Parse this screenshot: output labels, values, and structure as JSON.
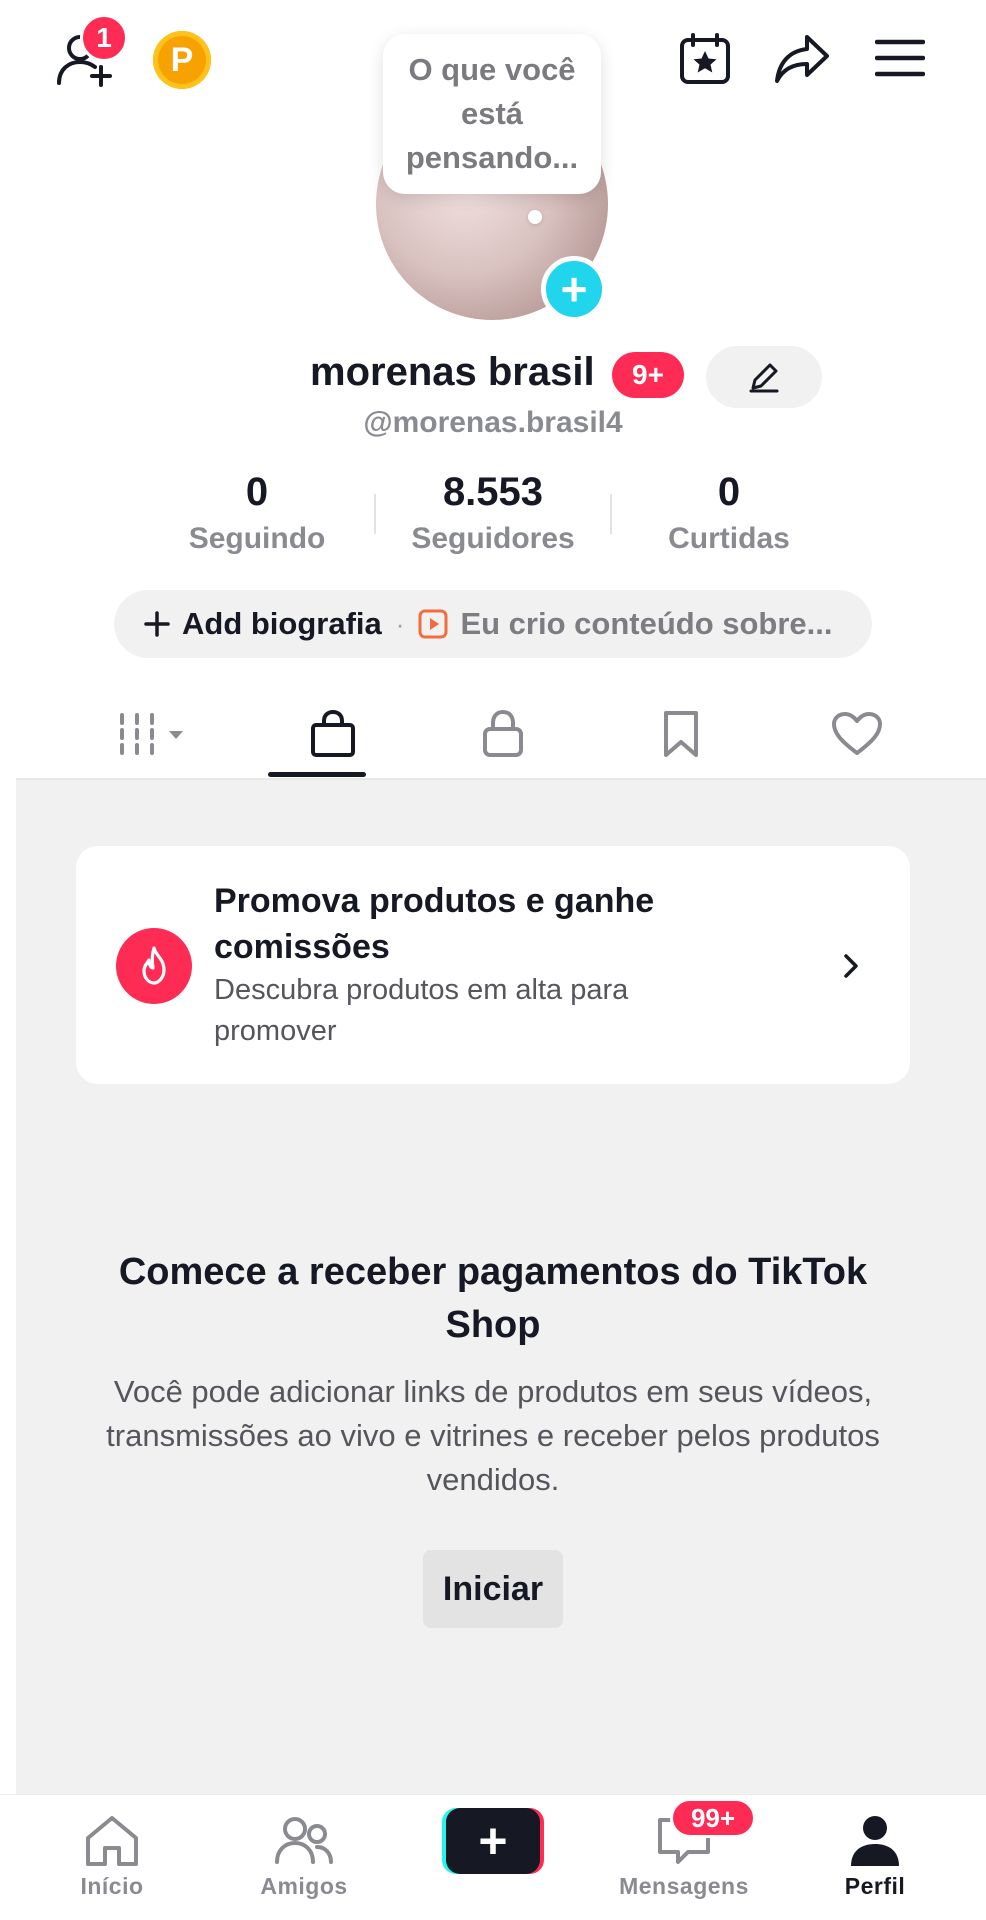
{
  "topbar": {
    "friends_badge": "1",
    "coin_label": "P"
  },
  "profile": {
    "thought_bubble": "O que você está pensando...",
    "display_name": "morenas brasil",
    "name_badge": "9+",
    "handle": "@morenas.brasil4"
  },
  "stats": [
    {
      "value": "0",
      "label": "Seguindo"
    },
    {
      "value": "8.553",
      "label": "Seguidores"
    },
    {
      "value": "0",
      "label": "Curtidas"
    }
  ],
  "bio": {
    "add_label": "Add biografia",
    "separator": "·",
    "hint": "Eu crio conteúdo sobre..."
  },
  "tabs": [
    {
      "icon": "grid-icon"
    },
    {
      "icon": "shopping-bag-icon"
    },
    {
      "icon": "lock-icon"
    },
    {
      "icon": "bookmark-icon"
    },
    {
      "icon": "heart-icon"
    }
  ],
  "promo": {
    "title": "Promova produtos e ganhe comissões",
    "subtitle": "Descubra produtos em alta para promover"
  },
  "shop": {
    "title": "Comece a receber pagamentos do TikTok Shop",
    "description": "Você pode adicionar links de produtos em seus vídeos, transmissões ao vivo e vitrines e receber pelos produtos vendidos.",
    "button": "Iniciar"
  },
  "bottom_nav": {
    "home": "Início",
    "friends": "Amigos",
    "messages": "Mensagens",
    "messages_badge": "99+",
    "profile": "Perfil"
  },
  "colors": {
    "accent_red": "#fe2c55",
    "accent_cyan": "#25f4ee",
    "coin": "#f7a200",
    "text": "#161823",
    "muted": "#8a8b91"
  }
}
